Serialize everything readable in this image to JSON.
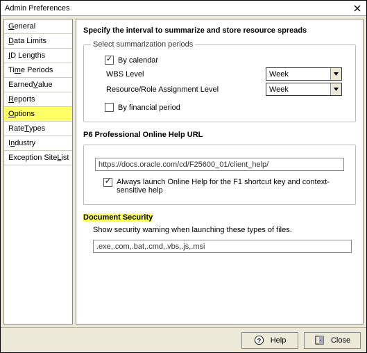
{
  "window": {
    "title": "Admin Preferences"
  },
  "sidebar": {
    "items": [
      {
        "pre": "",
        "u": "G",
        "post": "eneral"
      },
      {
        "pre": "",
        "u": "D",
        "post": "ata Limits"
      },
      {
        "pre": "",
        "u": "I",
        "post": "D Lengths"
      },
      {
        "pre": "Ti",
        "u": "m",
        "post": "e Periods"
      },
      {
        "pre": "Earned ",
        "u": "V",
        "post": "alue"
      },
      {
        "pre": "",
        "u": "R",
        "post": "eports"
      },
      {
        "pre": "",
        "u": "O",
        "post": "ptions"
      },
      {
        "pre": "Rate ",
        "u": "T",
        "post": "ypes"
      },
      {
        "pre": "I",
        "u": "n",
        "post": "dustry"
      },
      {
        "pre": "Exception Site ",
        "u": "L",
        "post": "ist"
      }
    ]
  },
  "content": {
    "heading": "Specify the interval to summarize and store resource spreads",
    "summ_legend": "Select summarization periods",
    "by_calendar": "By calendar",
    "wbs_label": "WBS Level",
    "wbs_value": "Week",
    "res_label": "Resource/Role Assignment Level",
    "res_value": "Week",
    "by_financial": "By financial period",
    "help_heading": "P6 Professional Online Help URL",
    "help_url": "https://docs.oracle.com/cd/F25600_01/client_help/",
    "help_chk": "Always launch Online Help for the F1 shortcut key and context-sensitive help",
    "doc_heading": "Document Security",
    "doc_text": "Show security warning when launching these types of files.",
    "doc_exts": ".exe,.com,.bat,.cmd,.vbs,.js,.msi"
  },
  "footer": {
    "help": "Help",
    "close": "Close"
  }
}
